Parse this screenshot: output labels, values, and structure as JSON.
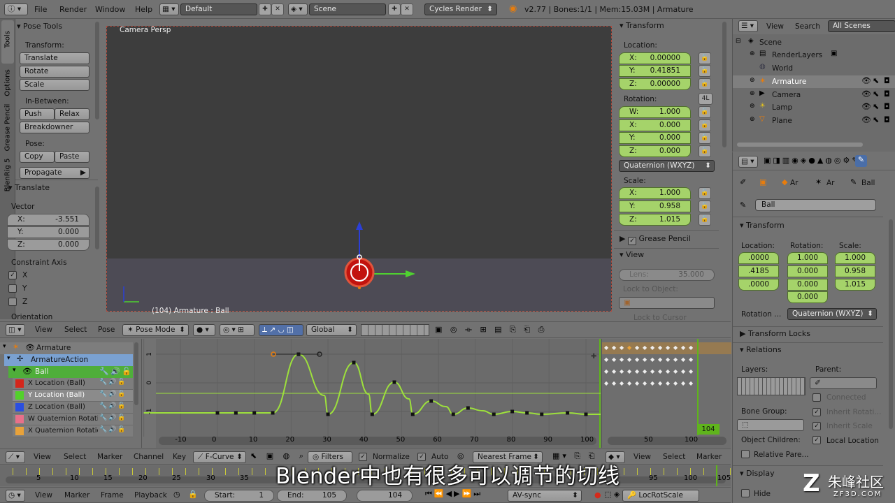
{
  "info_header": {
    "menus": [
      "File",
      "Render",
      "Window",
      "Help"
    ],
    "layout": "Default",
    "scene": "Scene",
    "engine": "Cycles Render",
    "stats": "v2.77 | Bones:1/1 | Mem:15.03M | Armature"
  },
  "tool_tabs": [
    "Tools",
    "Options",
    "Grease Pencil",
    "BlenRig 5"
  ],
  "pose_tools": {
    "title": "Pose Tools",
    "transform_label": "Transform:",
    "translate": "Translate",
    "rotate": "Rotate",
    "scale": "Scale",
    "inbetween_label": "In-Between:",
    "push": "Push",
    "relax": "Relax",
    "breakdowner": "Breakdowner",
    "pose_label": "Pose:",
    "copy": "Copy",
    "paste": "Paste",
    "propagate": "Propagate"
  },
  "translate_op": {
    "title": "Translate",
    "vector_label": "Vector",
    "x_label": "X:",
    "x": "-3.551",
    "y_label": "Y:",
    "y": "0.000",
    "z_label": "Z:",
    "z": "0.000",
    "constraint_label": "Constraint Axis",
    "cx": "X",
    "cy": "Y",
    "cz": "Z",
    "orientation": "Orientation"
  },
  "viewport": {
    "label": "Camera Persp",
    "status": "(104) Armature : Ball"
  },
  "view3d_header": {
    "menus": [
      "View",
      "Select",
      "Pose"
    ],
    "mode": "Pose Mode",
    "orientation": "Global"
  },
  "n_panel": {
    "transform": "Transform",
    "location_label": "Location:",
    "loc_x_label": "X:",
    "loc_x": "0.00000",
    "loc_y_label": "Y:",
    "loc_y": "0.41851",
    "loc_z_label": "Z:",
    "loc_z": "0.00000",
    "rotation_label": "Rotation:",
    "rot_w_label": "W:",
    "rot_w": "1.000",
    "rot_x_label": "X:",
    "rot_x": "0.000",
    "rot_y_label": "Y:",
    "rot_y": "0.000",
    "rot_z_label": "Z:",
    "rot_z": "0.000",
    "rot_lock": "4L",
    "rot_mode": "Quaternion (WXYZ)",
    "scale_label": "Scale:",
    "sc_x_label": "X:",
    "sc_x": "1.000",
    "sc_y_label": "Y:",
    "sc_y": "0.958",
    "sc_z_label": "Z:",
    "sc_z": "1.015",
    "grease_pencil": "Grease Pencil",
    "view": "View",
    "lens_label": "Lens:",
    "lens": "35.000",
    "lock_to_object": "Lock to Object:",
    "lock_to_cursor": "Lock to Cursor"
  },
  "outliner_header": {
    "view": "View",
    "search": "Search",
    "filter": "All Scenes"
  },
  "outliner": {
    "scene": "Scene",
    "render_layers": "RenderLayers",
    "world": "World",
    "armature": "Armature",
    "camera": "Camera",
    "lamp": "Lamp",
    "plane": "Plane"
  },
  "properties": {
    "crumb1": "Ar",
    "crumb2": "Ar",
    "crumb3": "Ball",
    "bone_name": "Ball",
    "transform": "Transform",
    "location_label": "Location:",
    "rotation_label": "Rotation:",
    "scale_label": "Scale:",
    "loc": [
      ".0000",
      ".4185",
      ".0000"
    ],
    "rot": [
      "1.000",
      "0.000",
      "0.000",
      "0.000"
    ],
    "scl": [
      "1.000",
      "0.958",
      "1.015"
    ],
    "rotation_mode_label": "Rotation ...",
    "rotation_mode": "Quaternion (WXYZ)",
    "transform_locks": "Transform Locks",
    "relations": "Relations",
    "layers_label": "Layers:",
    "parent_label": "Parent:",
    "connected": "Connected",
    "bone_group_label": "Bone Group:",
    "inherit_rotation": "Inherit Rotati...",
    "inherit_scale": "Inherit Scale",
    "object_children": "Object Children:",
    "local_location": "Local Location",
    "relative_parent": "Relative Pare...",
    "display": "Display",
    "hide": "Hide"
  },
  "channels": {
    "armature": "Armature",
    "action": "ArmatureAction",
    "bone": "Ball",
    "items": [
      {
        "label": "X Location (Ball)",
        "color": "#d4261b"
      },
      {
        "label": "Y Location (Ball)",
        "color": "#52d12a"
      },
      {
        "label": "Z Location (Ball)",
        "color": "#2a4ee0"
      },
      {
        "label": "W Quaternion Rotatio",
        "color": "#e8708a"
      },
      {
        "label": "X Quaternion Rotatio",
        "color": "#e8a23a"
      }
    ]
  },
  "graph": {
    "x_ticks": [
      "-10",
      "0",
      "10",
      "20",
      "30",
      "40",
      "50",
      "60",
      "70",
      "80",
      "90",
      "100"
    ],
    "y_ticks": [
      "1",
      "0",
      "-1"
    ],
    "current_frame": "104",
    "dope_ticks": [
      "50",
      "100"
    ]
  },
  "graph_header": {
    "menus": [
      "View",
      "Select",
      "Marker",
      "Channel",
      "Key"
    ],
    "mode": "F-Curve",
    "filters": "Filters",
    "normalize": "Normalize",
    "auto": "Auto",
    "snap": "Nearest Frame",
    "dope_menus": [
      "View",
      "Select",
      "Marker"
    ]
  },
  "timeline": {
    "ticks": [
      "5",
      "10",
      "15",
      "20",
      "25",
      "30",
      "35",
      "95",
      "100",
      "105"
    ]
  },
  "timeline_header": {
    "menus": [
      "View",
      "Marker",
      "Frame",
      "Playback"
    ],
    "start_label": "Start:",
    "start": "1",
    "end_label": "End:",
    "end": "105",
    "current": "104",
    "sync": "AV-sync",
    "keying": "LocRotScale"
  },
  "subtitle": "Blender中也有很多可以调节的切线",
  "watermark": {
    "brand": "朱峰社区",
    "site": "ZF3D.COM"
  },
  "colors": {
    "header": "#727272",
    "viewport": "#3d3d3d",
    "graph_bg": "#6b6b6b",
    "curve": "#9de03c",
    "selected_green": "#a5d36a",
    "current_frame": "#5fb41c"
  }
}
